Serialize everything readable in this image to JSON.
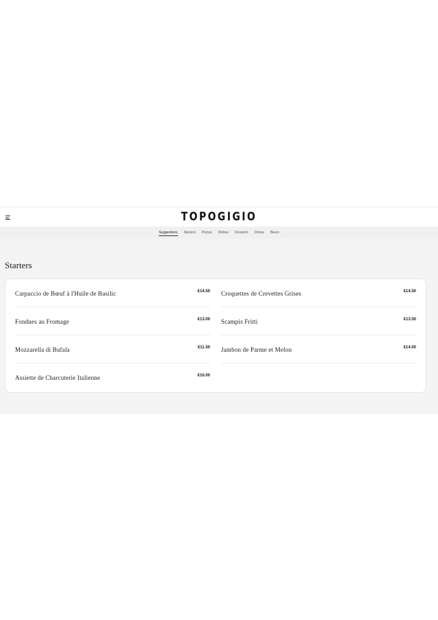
{
  "header": {
    "logo": "TOPOGIGIO",
    "menu_icon": "hamburger-icon"
  },
  "nav": {
    "tabs": [
      {
        "label": "Suggestions",
        "active": true
      },
      {
        "label": "Starters",
        "active": false
      },
      {
        "label": "Pizzas",
        "active": false
      },
      {
        "label": "Dishes",
        "active": false
      },
      {
        "label": "Desserts",
        "active": false
      },
      {
        "label": "Drinks",
        "active": false
      },
      {
        "label": "Beers",
        "active": false
      }
    ]
  },
  "section": {
    "title": "Starters",
    "items": [
      {
        "name": "Carpaccio de Bœuf à l'Huile de Basilic",
        "price": "€14.50"
      },
      {
        "name": "Croquettes de Crevettes Grises",
        "price": "€14.50"
      },
      {
        "name": "Fondues au Fromage",
        "price": "€13.00"
      },
      {
        "name": "Scampis Fritti",
        "price": "€13.50"
      },
      {
        "name": "Mozzarella di Bufala",
        "price": "€11.50"
      },
      {
        "name": "Jambon de Parme et Melon",
        "price": "€14.00"
      },
      {
        "name": "Assiette de Charcuterie Italienne",
        "price": "€16.00"
      }
    ]
  }
}
